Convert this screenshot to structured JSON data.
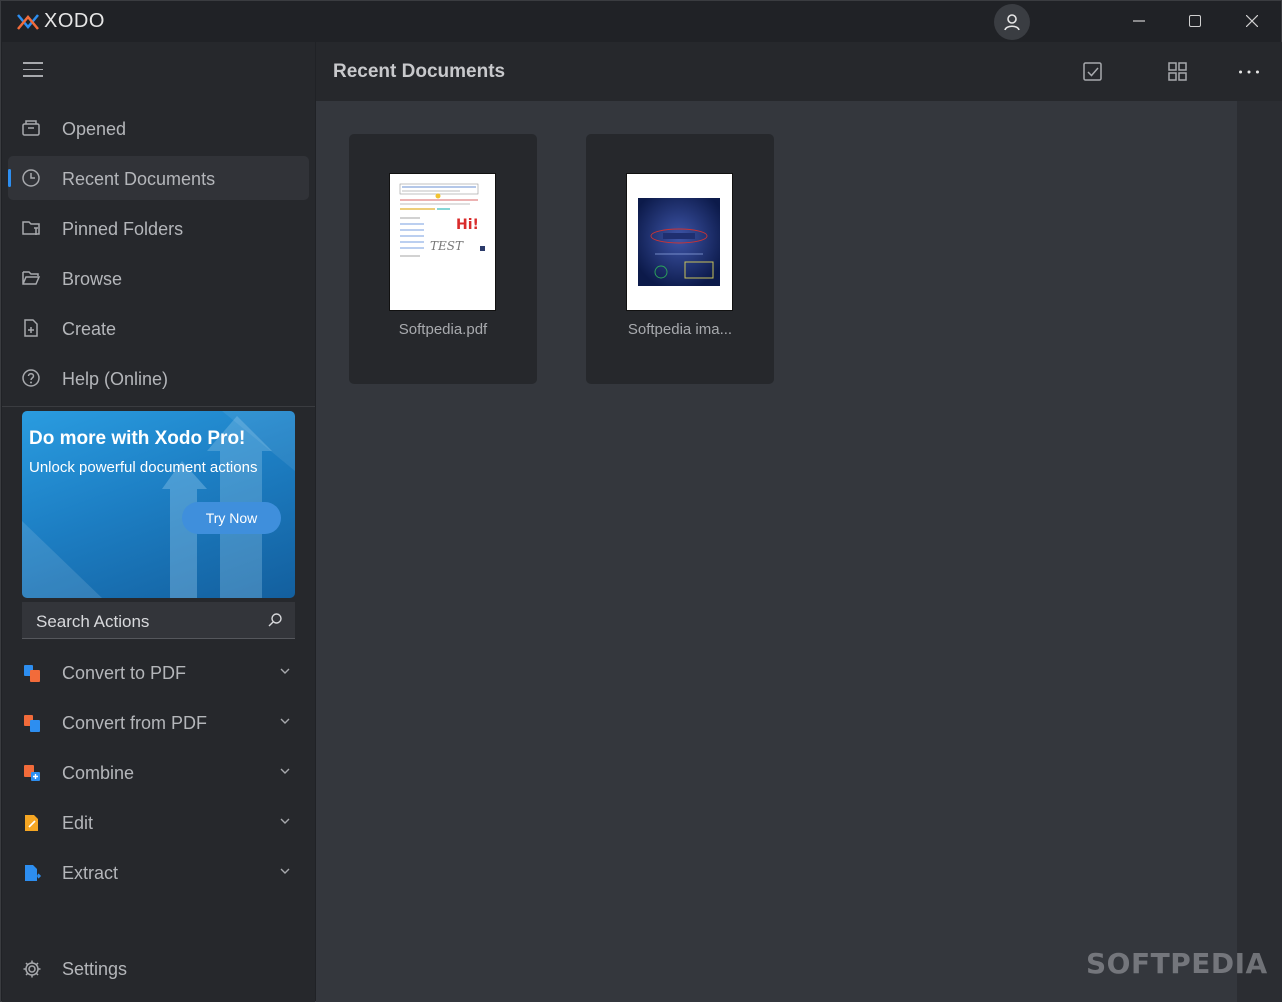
{
  "app": {
    "logo_text": "XODO"
  },
  "sidebar": {
    "nav": [
      {
        "label": "Opened",
        "icon": "opened-icon"
      },
      {
        "label": "Recent Documents",
        "icon": "clock-icon",
        "active": true
      },
      {
        "label": "Pinned Folders",
        "icon": "pinned-folder-icon"
      },
      {
        "label": "Browse",
        "icon": "folder-open-icon"
      },
      {
        "label": "Create",
        "icon": "new-file-icon"
      },
      {
        "label": "Help (Online)",
        "icon": "help-icon"
      }
    ],
    "promo": {
      "title": "Do more with Xodo Pro!",
      "subtitle": "Unlock powerful document actions",
      "button": "Try Now"
    },
    "search": {
      "placeholder": "Search Actions"
    },
    "actions": [
      {
        "label": "Convert to PDF",
        "icon": "convert-to-pdf-icon",
        "color": "#f26b3a"
      },
      {
        "label": "Convert from PDF",
        "icon": "convert-from-pdf-icon",
        "color": "#f26b3a"
      },
      {
        "label": "Combine",
        "icon": "combine-icon",
        "color": "#f26b3a"
      },
      {
        "label": "Edit",
        "icon": "edit-icon",
        "color": "#f5a623"
      },
      {
        "label": "Extract",
        "icon": "extract-icon",
        "color": "#2d8ef0"
      }
    ],
    "settings": {
      "label": "Settings"
    }
  },
  "main": {
    "title": "Recent Documents",
    "documents": [
      {
        "name": "Softpedia.pdf"
      },
      {
        "name": "Softpedia ima..."
      }
    ],
    "watermark": "SOFTPEDIA"
  },
  "colors": {
    "accent": "#2d8ef0",
    "background": "#202226",
    "content": "#34373d"
  }
}
